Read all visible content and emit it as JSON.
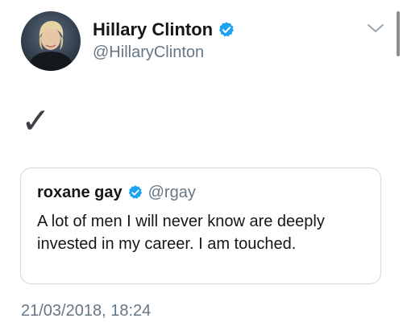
{
  "author": {
    "display_name": "Hillary Clinton",
    "handle": "@HillaryClinton",
    "verified": true,
    "avatar_icon": "profile-photo-avatar"
  },
  "tweet": {
    "text": "✓"
  },
  "quoted_tweet": {
    "display_name": "roxane gay",
    "handle": "@rgay",
    "verified": true,
    "text": "A lot of men I will never know are deeply invested in my career. I am touched."
  },
  "timestamp": "21/03/2018, 18:24",
  "icons": {
    "verified": "verified-badge-icon",
    "menu": "chevron-down-icon"
  },
  "colors": {
    "verified_blue": "#1da1f2",
    "secondary_text": "#657786",
    "primary_text": "#14171a",
    "border": "#cfd9de"
  }
}
